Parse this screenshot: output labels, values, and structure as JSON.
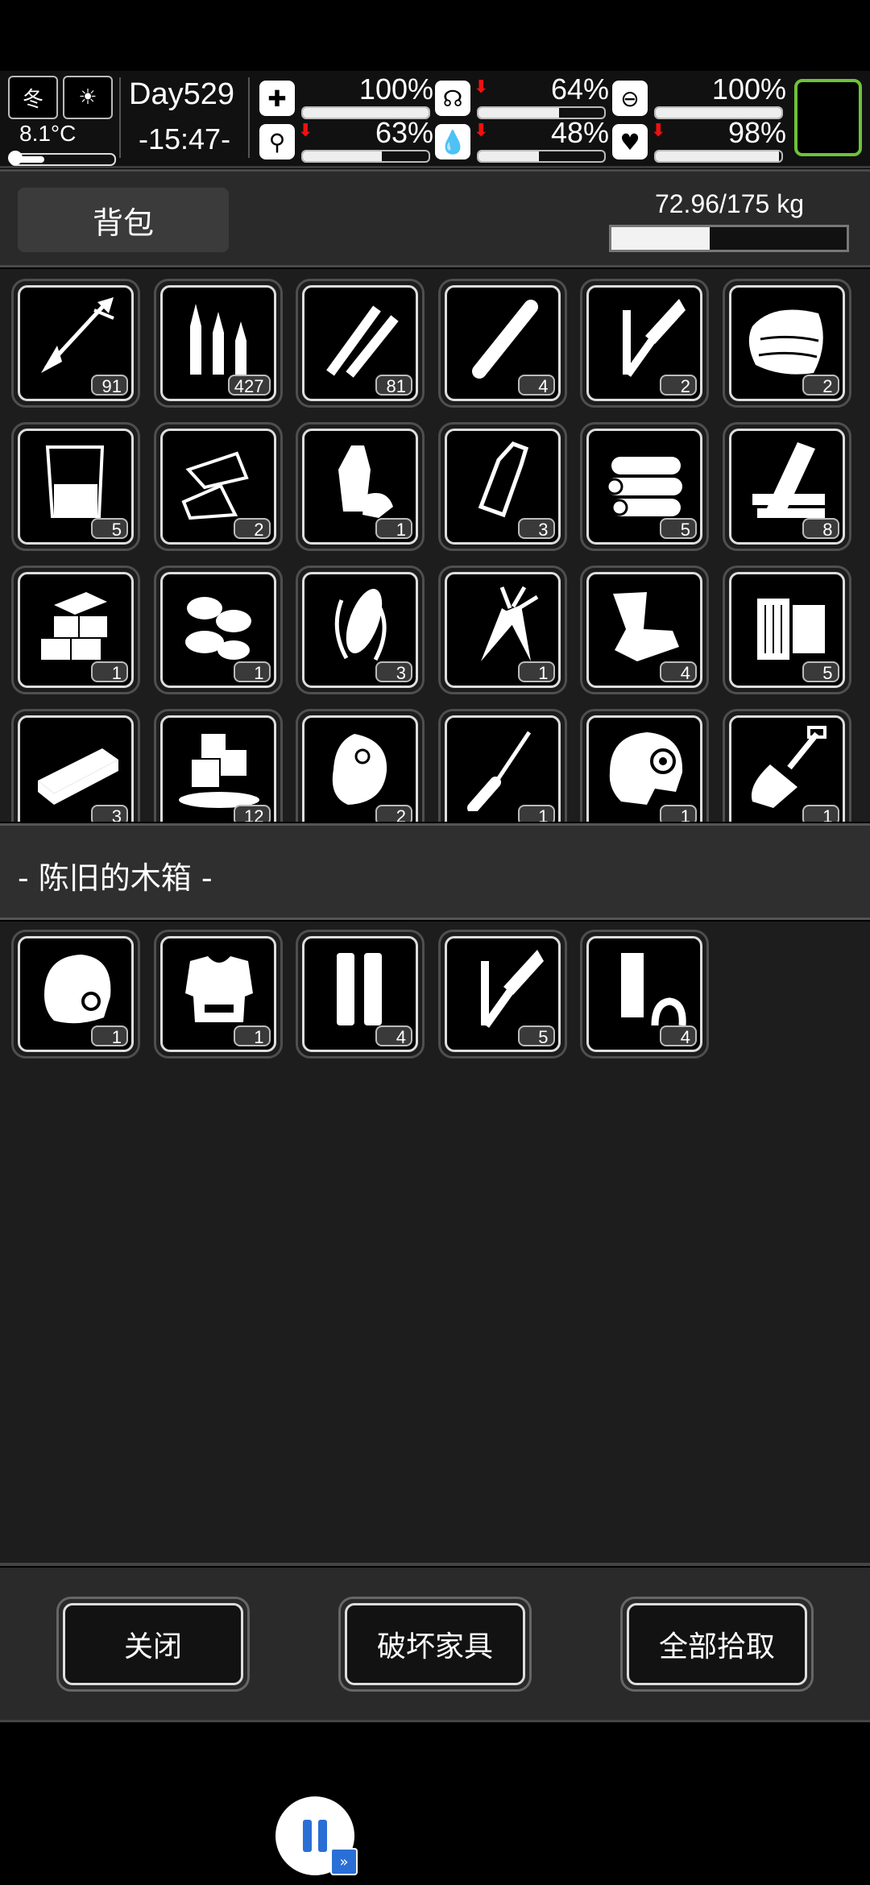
{
  "status": {
    "season_icon": "winter-snowflake-icon",
    "season_label": "冬",
    "weather_icon": "sun-icon",
    "temperature": "8.1°C",
    "temperature_level": 0.3,
    "day": "Day529",
    "time": "-15:47-",
    "stats": [
      {
        "name": "health",
        "icon": "medkit-icon",
        "glyph": "✚",
        "value": "100%",
        "level": 1.0,
        "dropping": false
      },
      {
        "name": "hunger",
        "icon": "stomach-icon",
        "glyph": "☊",
        "value": "64%",
        "level": 0.64,
        "dropping": true
      },
      {
        "name": "energy",
        "icon": "pill-icon",
        "glyph": "⊖",
        "value": "100%",
        "level": 1.0,
        "dropping": false
      },
      {
        "name": "stamina",
        "icon": "foot-icon",
        "glyph": "⚲",
        "value": "63%",
        "level": 0.63,
        "dropping": true
      },
      {
        "name": "thirst",
        "icon": "water-drop-icon",
        "glyph": "💧",
        "value": "48%",
        "level": 0.48,
        "dropping": true
      },
      {
        "name": "mood",
        "icon": "heart-icon",
        "glyph": "♥",
        "value": "98%",
        "level": 0.98,
        "dropping": true
      }
    ],
    "equip_slot_color": "#6ec23b"
  },
  "backpack": {
    "tab_label": "背包",
    "weight": "72.96/175 kg",
    "weight_level": 0.4169,
    "items": [
      {
        "icon": "arrow-icon",
        "count": "91"
      },
      {
        "icon": "rifle-bullets-icon",
        "count": "427"
      },
      {
        "icon": "bullets-icon",
        "count": "81"
      },
      {
        "icon": "cylinder-icon",
        "count": "4"
      },
      {
        "icon": "soldering-iron-icon",
        "count": "2"
      },
      {
        "icon": "cloth-icon",
        "count": "2"
      },
      {
        "icon": "beaker-icon",
        "count": "5"
      },
      {
        "icon": "paper-scraps-icon",
        "count": "2"
      },
      {
        "icon": "plastic-bottle-icon",
        "count": "1"
      },
      {
        "icon": "glass-bottle-icon",
        "count": "3"
      },
      {
        "icon": "logs-icon",
        "count": "5"
      },
      {
        "icon": "planks-icon",
        "count": "8"
      },
      {
        "icon": "bricks-icon",
        "count": "1"
      },
      {
        "icon": "seeds-icon",
        "count": "1"
      },
      {
        "icon": "corn-icon",
        "count": "3"
      },
      {
        "icon": "carrot-icon",
        "count": "1"
      },
      {
        "icon": "scrap-metal-icon",
        "count": "4"
      },
      {
        "icon": "wood-blocks-icon",
        "count": "5"
      },
      {
        "icon": "board-icon",
        "count": "3"
      },
      {
        "icon": "ice-icon",
        "count": "12"
      },
      {
        "icon": "meat-icon",
        "count": "2"
      },
      {
        "icon": "screwdriver-icon",
        "count": "1"
      },
      {
        "icon": "tactical-helmet-icon",
        "count": "1"
      },
      {
        "icon": "shovel-icon",
        "count": "1"
      }
    ]
  },
  "crate": {
    "title": "- 陈旧的木箱 -",
    "items": [
      {
        "icon": "helmet-icon",
        "count": "1"
      },
      {
        "icon": "body-armor-icon",
        "count": "1"
      },
      {
        "icon": "shell-casings-icon",
        "count": "4"
      },
      {
        "icon": "soldering-iron-icon",
        "count": "5"
      },
      {
        "icon": "pipe-icon",
        "count": "4"
      }
    ]
  },
  "buttons": {
    "close": "关闭",
    "destroy": "破坏家具",
    "take_all": "全部拾取"
  }
}
